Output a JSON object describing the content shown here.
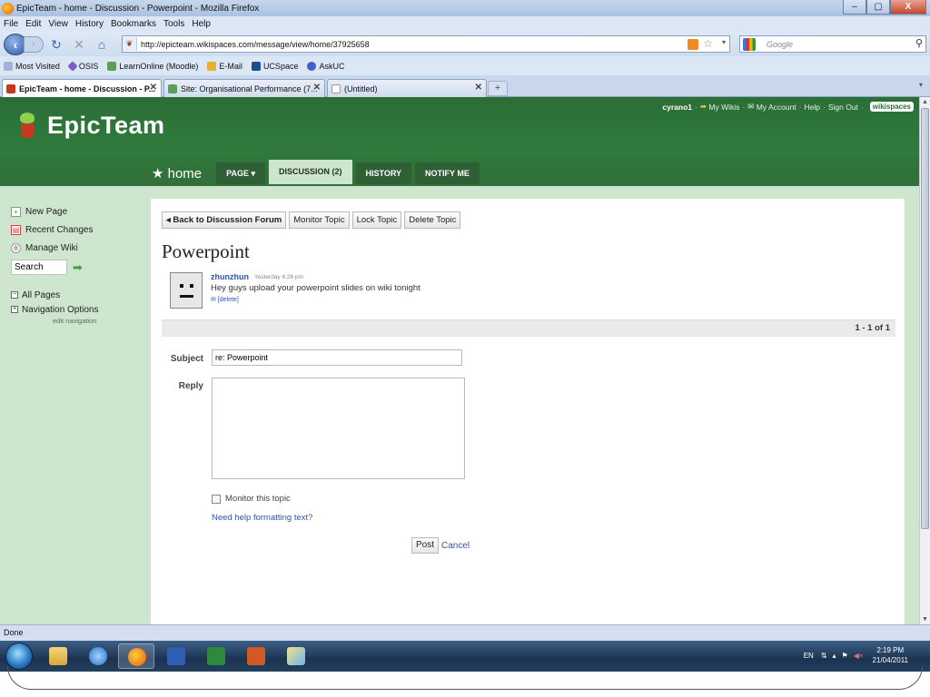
{
  "window": {
    "title": "EpicTeam - home - Discussion - Powerpoint - Mozilla Firefox",
    "min": "–",
    "max": "▢",
    "close": "X"
  },
  "menu": [
    "File",
    "Edit",
    "View",
    "History",
    "Bookmarks",
    "Tools",
    "Help"
  ],
  "nav": {
    "url": "http://epicteam.wikispaces.com/message/view/home/37925658",
    "search_placeholder": "Google"
  },
  "bookmarks": [
    "Most Visited",
    "OSIS",
    "LearnOnline (Moodle)",
    "E-Mail",
    "UCSpace",
    "AskUC"
  ],
  "tabs": [
    "EpicTeam - home - Discussion - P...",
    "Site: Organisational Performance (7...",
    "(Untitled)"
  ],
  "site": {
    "name": "EpicTeam",
    "user": "cyrano1",
    "user_links": [
      "My Wikis",
      "My Account",
      "Help",
      "Sign Out"
    ],
    "badge": "wikispaces",
    "home_tab": "★ home",
    "page_tabs": [
      "PAGE ▾",
      "DISCUSSION (2)",
      "HISTORY",
      "NOTIFY ME"
    ]
  },
  "sidebar": {
    "items": [
      "New Page",
      "Recent Changes",
      "Manage Wiki"
    ],
    "search_value": "Search",
    "tree": [
      "All Pages",
      "Navigation Options"
    ],
    "edit_nav": "edit navigation"
  },
  "topic": {
    "buttons": [
      "◂ Back to Discussion Forum",
      "Monitor Topic",
      "Lock Topic",
      "Delete Topic"
    ],
    "title": "Powerpoint",
    "author": "zhunzhun",
    "time": "Yesterday 6:26 pm",
    "body": "Hey guys upload your powerpoint slides on wiki tonight",
    "delete_link": "✉ [delete]",
    "pager": "1 - 1 of 1"
  },
  "reply_form": {
    "subject_label": "Subject",
    "subject_value": "re: Powerpoint",
    "reply_label": "Reply",
    "monitor_label": "Monitor this topic",
    "help_link": "Need help formatting text?",
    "post_button": "Post",
    "cancel_link": "Cancel"
  },
  "status": "Done",
  "tray": {
    "lang": "EN",
    "time": "2:19 PM",
    "date": "21/04/2011"
  },
  "colors": {
    "header_green": "#2f7a3c",
    "page_bg": "#cde6cd",
    "link_blue": "#2d55b2"
  }
}
